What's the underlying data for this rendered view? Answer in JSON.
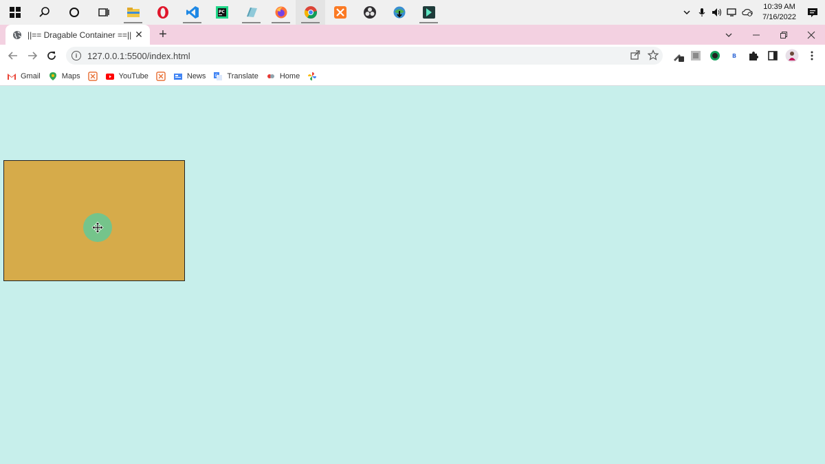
{
  "taskbar": {
    "apps": [
      {
        "name": "start-icon"
      },
      {
        "name": "search-icon"
      },
      {
        "name": "cortana-icon"
      },
      {
        "name": "task-view-icon"
      },
      {
        "name": "file-explorer-icon"
      },
      {
        "name": "opera-icon"
      },
      {
        "name": "vscode-icon"
      },
      {
        "name": "pycharm-icon"
      },
      {
        "name": "notepad-icon"
      },
      {
        "name": "firefox-icon"
      },
      {
        "name": "chrome-icon"
      },
      {
        "name": "xampp-icon"
      },
      {
        "name": "obs-icon"
      },
      {
        "name": "idm-icon"
      },
      {
        "name": "filmora-icon"
      }
    ],
    "time": "10:39 AM",
    "date": "7/16/2022"
  },
  "browser": {
    "tab_title": "||== Dragable Container ==||",
    "close_tab": "✕",
    "new_tab": "+",
    "url": "127.0.0.1:5500/index.html"
  },
  "bookmarks": [
    {
      "label": "Gmail",
      "color": "#ea4335"
    },
    {
      "label": "Maps",
      "color": "#34a853"
    },
    {
      "label": "",
      "color": "#e8743b"
    },
    {
      "label": "YouTube",
      "color": "#ff0000"
    },
    {
      "label": "",
      "color": "#e8743b"
    },
    {
      "label": "News",
      "color": "#4285f4"
    },
    {
      "label": "Translate",
      "color": "#4285f4"
    },
    {
      "label": "Home",
      "color": "#e53935"
    },
    {
      "label": "",
      "color": "#fbbc05"
    }
  ],
  "colors": {
    "page_background": "#c7efeb",
    "container": "#d6ab4a",
    "tabstrip": "#f3d1e1",
    "cursor_halo": "#64c896"
  }
}
